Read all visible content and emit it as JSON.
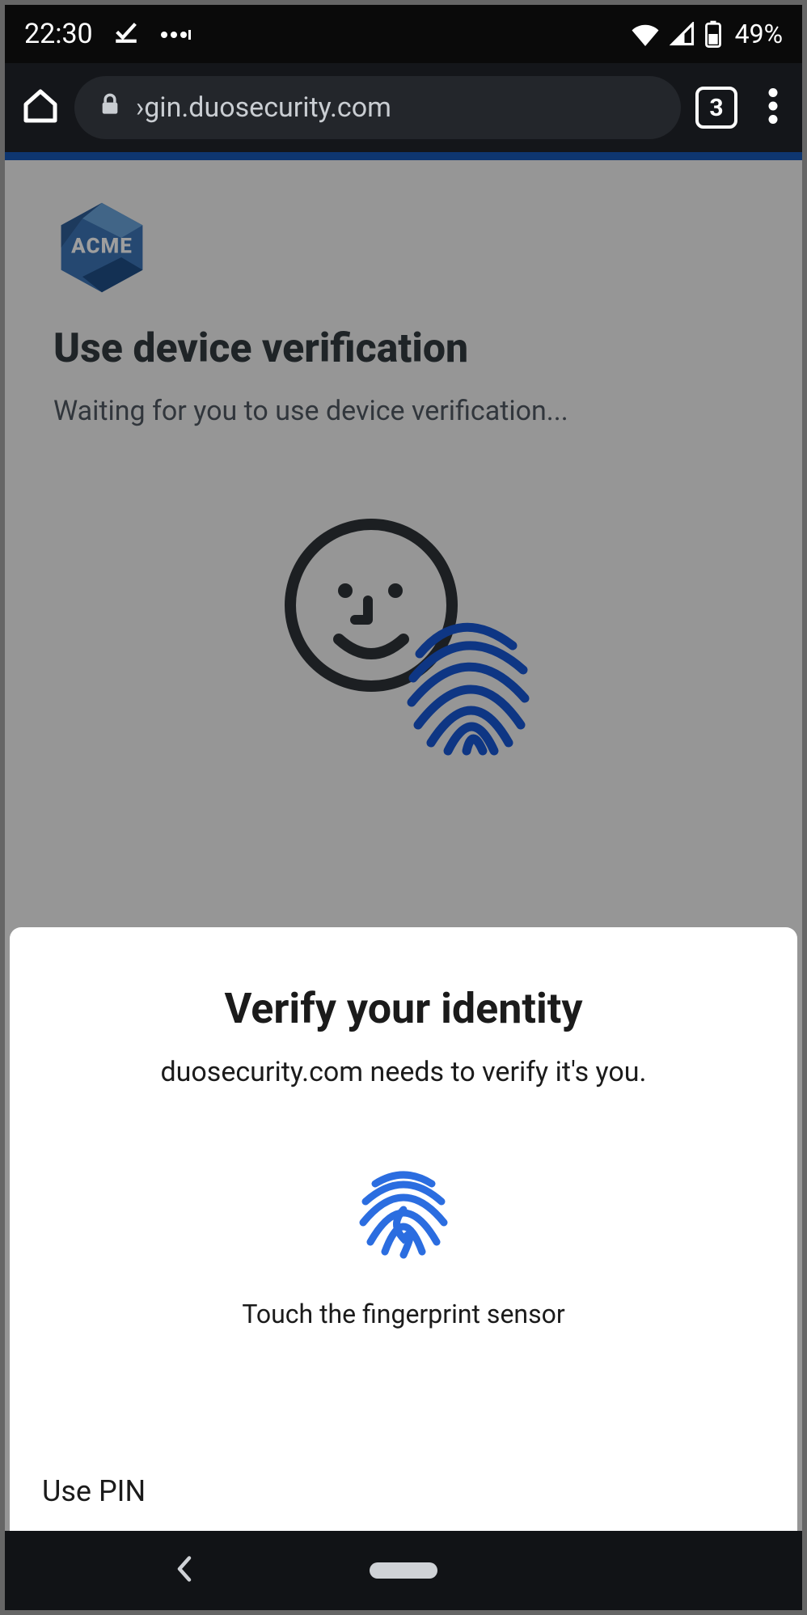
{
  "status": {
    "time": "22:30",
    "battery_text": "49%"
  },
  "browser": {
    "url_display": "›gin.duosecurity.com",
    "tab_count": "3"
  },
  "page": {
    "logo_text": "ACME",
    "title": "Use device verification",
    "subtitle": "Waiting for you to use device verification..."
  },
  "sheet": {
    "title": "Verify your identity",
    "subtitle": "duosecurity.com needs to verify it's you.",
    "instruction": "Touch the fingerprint sensor",
    "use_pin_label": "Use PIN"
  }
}
